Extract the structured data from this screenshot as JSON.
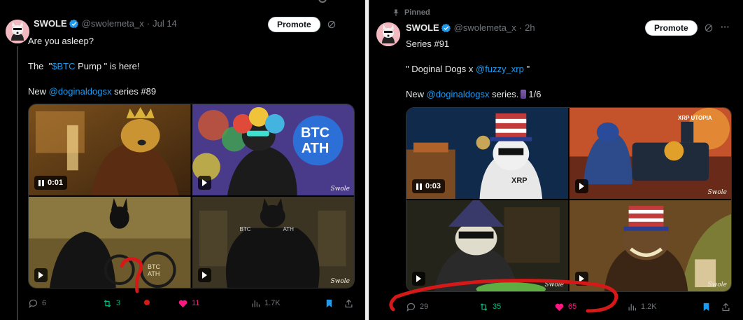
{
  "left_post": {
    "author": {
      "name": "SWOLE",
      "handle": "@swolemeta_x",
      "time": "Jul 14"
    },
    "promote_label": "Promote",
    "lines": {
      "l1": "Are you asleep?",
      "l2_pre": "The  \"",
      "l2_link": "$BTC",
      "l2_post": " Pump \" is here!",
      "l3_pre": "New ",
      "l3_link": "@doginaldogsx",
      "l3_post": " series #89"
    },
    "media": [
      {
        "badge": "0:01",
        "type": "video-playing"
      },
      {
        "badge": "",
        "type": "video",
        "overlay_text_1": "BTC",
        "overlay_text_2": "ATH"
      },
      {
        "badge": "",
        "type": "video",
        "overlay_text_1": "BTC",
        "overlay_text_2": "ATH"
      },
      {
        "badge": "",
        "type": "video",
        "overlay_text_1": "BTC",
        "overlay_text_2": "ATH"
      }
    ],
    "signature": "Swole",
    "actions": {
      "replies": "6",
      "reposts": "3",
      "likes": "11",
      "views": "1.7K"
    }
  },
  "right_post": {
    "pinned_label": "Pinned",
    "author": {
      "name": "SWOLE",
      "handle": "@swolemeta_x",
      "time": "2h"
    },
    "promote_label": "Promote",
    "lines": {
      "l1": "Series #91",
      "l2": "\" Doginal Dogs x ",
      "l2_link": "@fuzzy_xrp",
      "l2_post": " \"",
      "l3_pre": "New ",
      "l3_link": "@doginaldogsx",
      "l3_post": " series.",
      "l3_count": "1/6"
    },
    "media": [
      {
        "badge": "0:03",
        "type": "video-playing",
        "overlay_text": "XRP"
      },
      {
        "badge": "",
        "type": "video",
        "overlay_text": "XRP UTOPIA"
      },
      {
        "badge": "",
        "type": "video"
      },
      {
        "badge": "",
        "type": "video"
      }
    ],
    "signature": "Swole",
    "actions": {
      "replies": "29",
      "reposts": "35",
      "likes": "65",
      "views": "1.2K"
    }
  },
  "colors": {
    "background": "#000000",
    "link": "#1d9bf0",
    "muted": "#71767b",
    "repost": "#00ba7c",
    "like": "#f91880",
    "annotation_red": "#d61818"
  },
  "icons": [
    "verified-badge-icon",
    "grok-icon",
    "reply-icon",
    "repost-icon",
    "like-icon",
    "views-icon",
    "bookmark-icon",
    "share-icon",
    "pin-icon",
    "play-icon",
    "pause-icon"
  ]
}
